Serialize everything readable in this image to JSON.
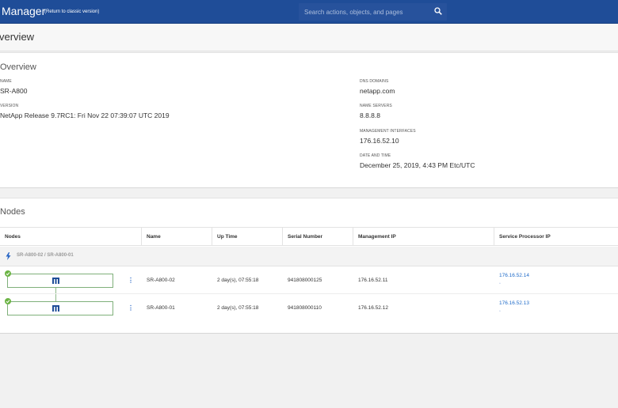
{
  "header": {
    "app_title": "Manager",
    "classic_link": "(Return to classic version)",
    "search_placeholder": "Search actions, objects, and pages",
    "search_icon": "search-icon"
  },
  "page": {
    "title": "verview"
  },
  "overview": {
    "title": "Overview",
    "left_fields": [
      {
        "label": "NAME",
        "value": "SR-A800"
      },
      {
        "label": "VERSION",
        "value": "NetApp Release 9.7RC1: Fri Nov 22 07:39:07 UTC 2019"
      }
    ],
    "right_fields": [
      {
        "label": "DNS DOMAINS",
        "value": "netapp.com"
      },
      {
        "label": "NAME SERVERS",
        "value": "8.8.8.8"
      },
      {
        "label": "MANAGEMENT INTERFACES",
        "value": "176.16.52.10"
      },
      {
        "label": "DATE AND TIME",
        "value": "December 25, 2019, 4:43 PM  Etc/UTC"
      }
    ]
  },
  "nodes": {
    "title": "Nodes",
    "columns": [
      "Nodes",
      "Name",
      "Up Time",
      "Serial Number",
      "Management IP",
      "Service Processor IP"
    ],
    "group_label": "SR-A800-02 / SR-A800-01",
    "rows": [
      {
        "name": "SR-A800-02",
        "uptime": "2 day(s), 07:55:18",
        "serial": "941808000125",
        "mgmt_ip": "176.16.52.11",
        "sp_ip": "176.16.52.14"
      },
      {
        "name": "SR-A800-01",
        "uptime": "2 day(s), 07:55:18",
        "serial": "941808000110",
        "mgmt_ip": "176.16.52.12",
        "sp_ip": "176.16.52.13"
      }
    ],
    "kebab": "⋮",
    "sub_glyph": "▫"
  },
  "colors": {
    "topbar": "#1f4d98",
    "link": "#1f6bc9",
    "status_ok": "#6cb445"
  }
}
